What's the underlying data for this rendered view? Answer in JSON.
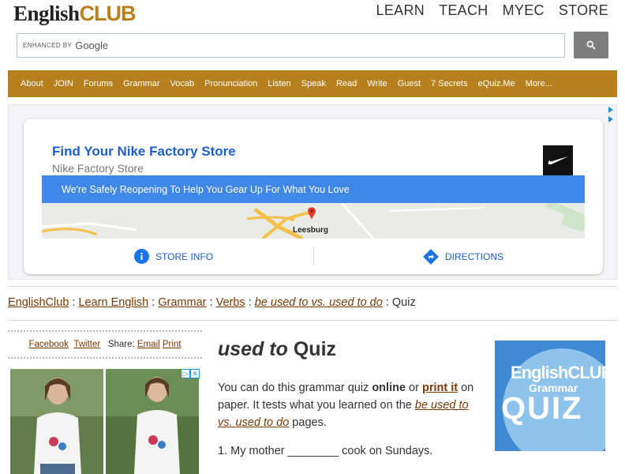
{
  "header": {
    "logo_main": "English",
    "logo_accent": "CLUB",
    "top_nav": [
      "LEARN",
      "TEACH",
      "MYEC",
      "STORE"
    ]
  },
  "search": {
    "enhanced_by": "ENHANCED BY",
    "provider": "Google"
  },
  "main_nav": [
    "About",
    "JOIN",
    "Forums",
    "Grammar",
    "Vocab",
    "Pronunciation",
    "Listen",
    "Speak",
    "Read",
    "Write",
    "Guest",
    "7 Secrets",
    "eQuiz.Me",
    "More..."
  ],
  "ad": {
    "title": "Find Your Nike Factory Store",
    "subtitle": "Nike Factory Store",
    "banner": "We're Safely Reopening To Help You Gear Up For What You Love",
    "map_label": "Leesburg",
    "store_info": "STORE INFO",
    "directions": "DIRECTIONS"
  },
  "breadcrumb": {
    "items": [
      "EnglishClub",
      "Learn English",
      "Grammar",
      "Verbs",
      "be used to vs. used to do"
    ],
    "current": "Quiz",
    "sep": " : "
  },
  "share": {
    "facebook": "Facebook",
    "twitter": "Twitter",
    "share_label": "Share:",
    "email": "Email",
    "print": "Print"
  },
  "quiz": {
    "title_em": "used to",
    "title_rest": " Quiz",
    "intro_1": "You can do this grammar quiz ",
    "intro_online": "online",
    "intro_or": " or ",
    "intro_print": "print it",
    "intro_2": " on paper. It tests what you learned on the ",
    "intro_link": "be used to vs. used to do",
    "intro_3": " pages.",
    "question_1": "1. My mother ________ cook on Sundays."
  },
  "quiz_logo": {
    "line1": "EnglishCLUB",
    "line2": "Grammar",
    "line3": "QUIZ"
  },
  "colors": {
    "brand_gold": "#b6801f",
    "link_brown": "#7a3a06",
    "ad_blue": "#1a5fd0",
    "banner_blue": "#3f88e8"
  }
}
